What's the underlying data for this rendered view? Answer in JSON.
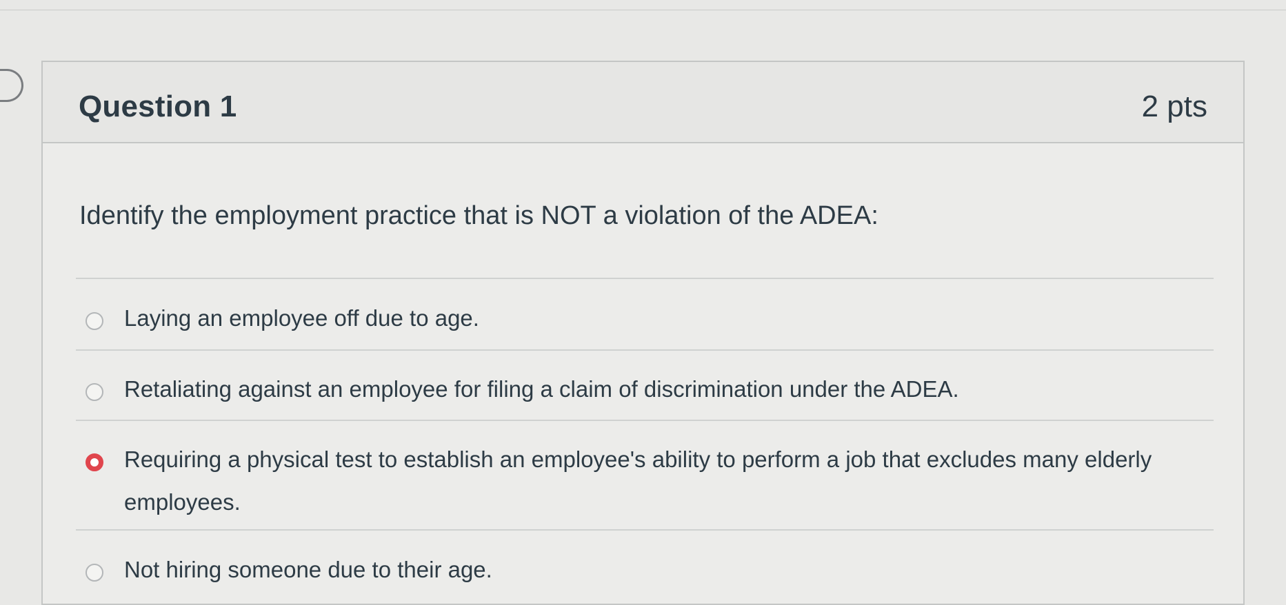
{
  "question": {
    "title": "Question 1",
    "points": "2 pts",
    "text": "Identify the employment practice that is NOT a violation of the ADEA:",
    "flag_icon": "bookmark-flag-icon"
  },
  "answers": [
    {
      "label": "Laying an employee off due to age.",
      "selected": false
    },
    {
      "label": "Retaliating against an employee for filing a claim of discrimination under the ADEA.",
      "selected": false
    },
    {
      "label": "Requiring a physical test to establish an employee's ability to perform a job that excludes many elderly employees.",
      "selected": true
    },
    {
      "label": "Not hiring someone due to their age.",
      "selected": false
    }
  ],
  "colors": {
    "selected_radio": "#e0454d",
    "text": "#2d3b45",
    "border": "#c4c6c5"
  }
}
